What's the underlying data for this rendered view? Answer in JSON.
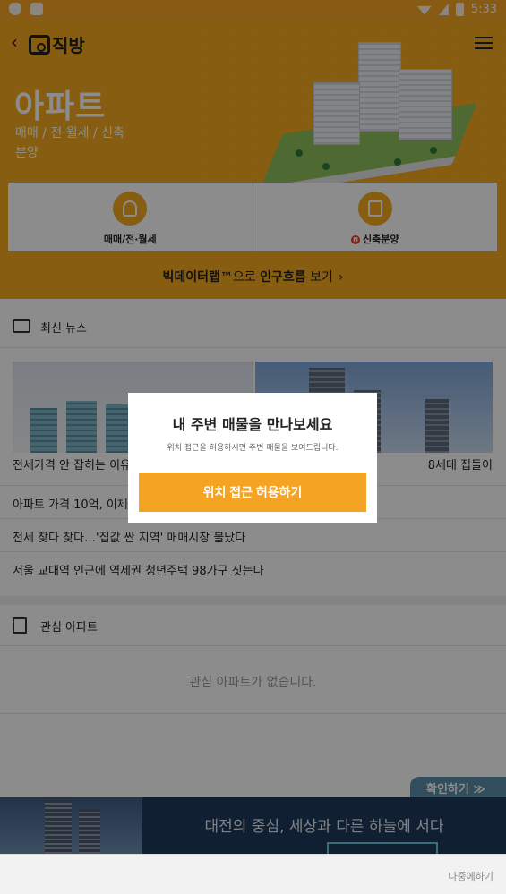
{
  "status_bar": {
    "time": "5:33",
    "icons": [
      "shield-icon",
      "a-icon",
      "wifi-icon",
      "signal-icon",
      "battery-icon"
    ]
  },
  "app": {
    "logo_text": "직방",
    "brand_color": "#f5a91f"
  },
  "hero": {
    "title": "아파트",
    "subtitle": "매매 / 전·월세 / 신축분양"
  },
  "tiles": [
    {
      "label": "매매/전·월세",
      "icon": "person-pin-icon"
    },
    {
      "label": "신축분양",
      "badge": "N",
      "icon": "building-doc-icon"
    }
  ],
  "bigdata": {
    "prefix": "빅데이터랩™",
    "middle": "으로 ",
    "emphasis": "인구흐름",
    "suffix": " 보기",
    "chevron": "›"
  },
  "news": {
    "title": "최신 뉴스",
    "captions": [
      "전세가격 안 잡히는 이유",
      "8세대 집들이"
    ],
    "items": [
      "아파트 가격 10억, 이제는",
      "전세 찾다 찾다…'집값 싼 지역' 매매시장 불났다",
      "서울 교대역 인근에 역세권 청년주택 98가구 짓는다"
    ]
  },
  "favorites": {
    "title": "관심 아파트",
    "empty_text": "관심 아파트가 없습니다."
  },
  "banner": {
    "confirm_label": "확인하기 ≫",
    "text": "대전의 중심, 세상과 다른 하늘에 서다"
  },
  "later": {
    "label": "나중에하기"
  },
  "modal": {
    "title": "내 주변 매물을 만나보세요",
    "description": "위치 접근을 허용하시면 주변 매물을 보여드립니다.",
    "button_label": "위치 접근 허용하기",
    "button_color": "#f5a323"
  }
}
